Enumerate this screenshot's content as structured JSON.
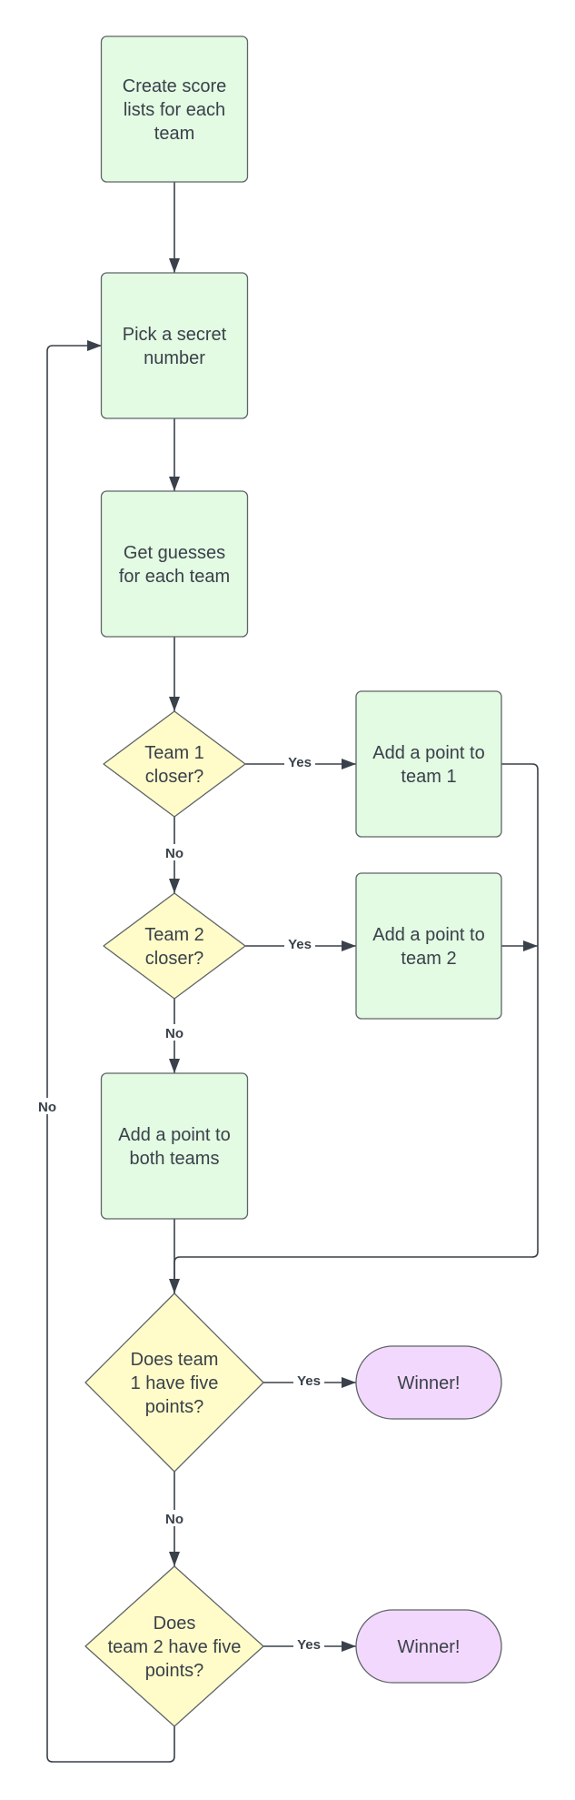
{
  "diagram": {
    "colors": {
      "process_fill": "#e3fae3",
      "decision_fill": "#fffcc9",
      "terminal_fill": "#f2d8fc",
      "stroke": "#5f6468",
      "text": "#3a414a"
    },
    "nodes": [
      {
        "id": "create-lists",
        "type": "process",
        "lines": [
          "Create score",
          "lists for each",
          "team"
        ]
      },
      {
        "id": "pick-number",
        "type": "process",
        "lines": [
          "Pick a secret",
          "number"
        ]
      },
      {
        "id": "get-guesses",
        "type": "process",
        "lines": [
          "Get guesses",
          "for each team"
        ]
      },
      {
        "id": "team1-closer",
        "type": "decision",
        "lines": [
          "Team 1",
          "closer?"
        ]
      },
      {
        "id": "add-team1",
        "type": "process",
        "lines": [
          "Add a point to",
          "team 1"
        ]
      },
      {
        "id": "team2-closer",
        "type": "decision",
        "lines": [
          "Team 2",
          "closer?"
        ]
      },
      {
        "id": "add-team2",
        "type": "process",
        "lines": [
          "Add a point to",
          "team 2"
        ]
      },
      {
        "id": "add-both",
        "type": "process",
        "lines": [
          "Add a point to",
          "both teams"
        ]
      },
      {
        "id": "team1-five",
        "type": "decision",
        "lines": [
          "Does team",
          "1 have five",
          "points?"
        ]
      },
      {
        "id": "winner1",
        "type": "terminal",
        "lines": [
          "Winner!"
        ]
      },
      {
        "id": "team2-five",
        "type": "decision",
        "lines": [
          "Does",
          "team 2 have five",
          "points?"
        ]
      },
      {
        "id": "winner2",
        "type": "terminal",
        "lines": [
          "Winner!"
        ]
      }
    ],
    "edges": [
      {
        "from": "create-lists",
        "to": "pick-number",
        "label": ""
      },
      {
        "from": "pick-number",
        "to": "get-guesses",
        "label": ""
      },
      {
        "from": "get-guesses",
        "to": "team1-closer",
        "label": ""
      },
      {
        "from": "team1-closer",
        "to": "add-team1",
        "label": "Yes"
      },
      {
        "from": "team1-closer",
        "to": "team2-closer",
        "label": "No"
      },
      {
        "from": "team2-closer",
        "to": "add-team2",
        "label": "Yes"
      },
      {
        "from": "team2-closer",
        "to": "add-both",
        "label": "No"
      },
      {
        "from": "add-team1",
        "to": "team1-five",
        "label": ""
      },
      {
        "from": "add-team2",
        "to": "team1-five",
        "label": ""
      },
      {
        "from": "add-both",
        "to": "team1-five",
        "label": ""
      },
      {
        "from": "team1-five",
        "to": "winner1",
        "label": "Yes"
      },
      {
        "from": "team1-five",
        "to": "team2-five",
        "label": "No"
      },
      {
        "from": "team2-five",
        "to": "winner2",
        "label": "Yes"
      },
      {
        "from": "team2-five",
        "to": "pick-number",
        "label": "No"
      }
    ]
  }
}
